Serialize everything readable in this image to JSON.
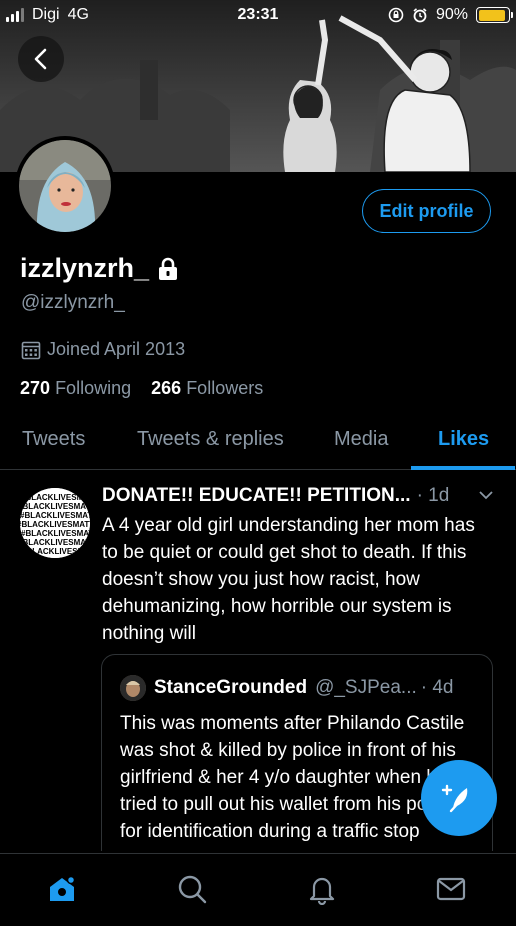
{
  "status_bar": {
    "carrier": "Digi",
    "network": "4G",
    "time": "23:31",
    "battery_percent": "90%",
    "battery_level": 0.9,
    "battery_color": "#f2c21b"
  },
  "profile": {
    "display_name": "izzlynzrh_",
    "handle": "@izzlynzrh_",
    "joined": "Joined April 2013",
    "following_count": "270",
    "following_label": "Following",
    "followers_count": "266",
    "followers_label": "Followers",
    "edit_profile_label": "Edit profile",
    "protected": true
  },
  "tabs": [
    {
      "label": "Tweets",
      "active": false
    },
    {
      "label": "Tweets & replies",
      "active": false
    },
    {
      "label": "Media",
      "active": false
    },
    {
      "label": "Likes",
      "active": true
    }
  ],
  "tweet": {
    "author": "DONATE!! EDUCATE!! PETITION...",
    "time": "· 1d",
    "body": "A 4 year old girl understanding her mom has to be quiet or could get shot to death. If this doesn’t show you just how racist, how dehumanizing, how horrible our system is nothing will",
    "avatar_text": "#BLACKLIVESMATTER",
    "quote": {
      "name": "StanceGrounded",
      "handle": "@_SJPea...",
      "time": "· 4d",
      "body": "This was moments after Philando Castile was shot & killed by police in front of his girlfriend & her 4 y/o daughter when he tried to pull out his wallet from his pocket for identification during a traffic stop"
    }
  },
  "colors": {
    "accent": "#1d9bf0",
    "secondary_text": "#8b98a5",
    "divider": "#2f3336",
    "background": "#000000"
  },
  "icons": {
    "back": "back-arrow-icon",
    "lock": "lock-icon",
    "calendar": "calendar-icon",
    "caret": "chevron-down-icon",
    "compose": "compose-tweet-icon",
    "nav": [
      "home-icon",
      "search-icon",
      "notifications-icon",
      "messages-icon"
    ]
  }
}
